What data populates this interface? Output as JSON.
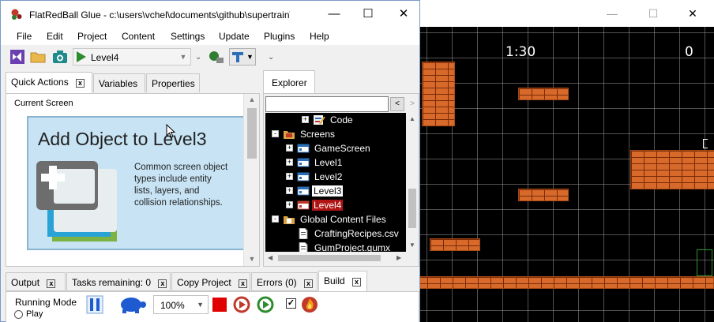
{
  "game": {
    "timer": "1:30",
    "score": "0",
    "controls": {
      "minimize": "—",
      "maximize": "☐",
      "close": "✕"
    }
  },
  "glue": {
    "title": "FlatRedBall Glue - c:\\users\\vchel\\documents\\github\\supertrain\\su...",
    "controls": {
      "minimize": "—",
      "maximize": "☐",
      "close": "✕"
    },
    "menu": [
      "File",
      "Edit",
      "Project",
      "Content",
      "Settings",
      "Update",
      "Plugins",
      "Help"
    ],
    "toolbar": {
      "screen_selected": "Level4",
      "overflow": "⌄"
    },
    "left_tabs": [
      {
        "label": "Quick Actions",
        "close": "x"
      },
      {
        "label": "Variables"
      },
      {
        "label": "Properties"
      }
    ],
    "quick_actions": {
      "section_label": "Current Screen",
      "card_title": "Add Object to Level3",
      "card_description": "Common screen object types include entity lists, layers, and collision relationships."
    },
    "explorer": {
      "tab_label": "Explorer",
      "search_placeholder": "",
      "back": "<",
      "forward": ">",
      "tree": [
        {
          "label": "Code",
          "level": 2,
          "icon": "code-icon",
          "expander": "+"
        },
        {
          "label": "Screens",
          "level": 0,
          "icon": "folder-icon",
          "expander": "-"
        },
        {
          "label": "GameScreen",
          "level": 1,
          "icon": "screen-icon",
          "expander": "+"
        },
        {
          "label": "Level1",
          "level": 1,
          "icon": "screen-icon",
          "expander": "+"
        },
        {
          "label": "Level2",
          "level": 1,
          "icon": "screen-icon",
          "expander": "+"
        },
        {
          "label": "Level3",
          "level": 1,
          "icon": "screen-icon",
          "expander": "+",
          "state": "highlighted"
        },
        {
          "label": "Level4",
          "level": 1,
          "icon": "screen-icon",
          "expander": "+",
          "state": "selected"
        },
        {
          "label": "Global Content Files",
          "level": 0,
          "icon": "folder-icon",
          "expander": "-"
        },
        {
          "label": "CraftingRecipes.csv",
          "level": 1,
          "icon": "file-icon",
          "expander": ""
        },
        {
          "label": "GumProject.gumx",
          "level": 1,
          "icon": "file-icon",
          "expander": ""
        }
      ]
    },
    "bottom_tabs": [
      {
        "label": "Output",
        "close": "x"
      },
      {
        "label": "Tasks remaining: 0",
        "close": "x"
      },
      {
        "label": "Copy Project",
        "close": "x"
      },
      {
        "label": "Errors (0)",
        "close": "x"
      },
      {
        "label": "Build",
        "close": "x"
      }
    ],
    "build": {
      "running_mode_label": "Running Mode",
      "play_radio_label": "Play",
      "zoom": "100%"
    }
  },
  "colors": {
    "selected_tree_bg": "#b01515",
    "highlight_tree_bg": "#ffffff",
    "card_bg": "#c7e3f4",
    "brick": "#d76a2a"
  }
}
